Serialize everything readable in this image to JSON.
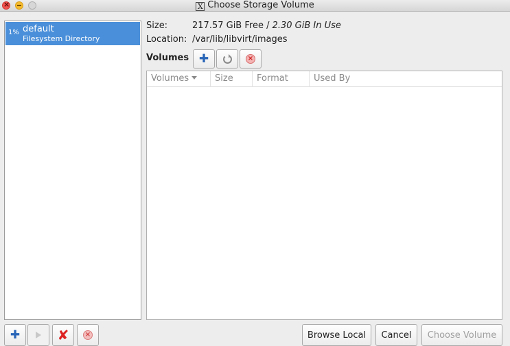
{
  "window": {
    "title": "Choose Storage Volume"
  },
  "pools": [
    {
      "usage": "1%",
      "name": "default",
      "type": "Filesystem Directory",
      "selected": true
    }
  ],
  "info": {
    "size_label": "Size:",
    "free": "217.57 GiB Free",
    "separator": " / ",
    "in_use": "2.30 GiB In Use",
    "location_label": "Location:",
    "location": "/var/lib/libvirt/images"
  },
  "volumes": {
    "heading": "Volumes",
    "columns": [
      "Volumes",
      "Size",
      "Format",
      "Used By"
    ],
    "rows": []
  },
  "buttons": {
    "browse_local": "Browse Local",
    "cancel": "Cancel",
    "choose_volume": "Choose Volume"
  },
  "icons": {
    "add_volume": "plus-icon",
    "refresh": "refresh-icon",
    "delete_volume": "stop-icon",
    "add_pool": "plus-icon",
    "start_pool": "play-icon",
    "delete_pool": "x-icon",
    "stop_pool": "stop-icon"
  },
  "colors": {
    "selection": "#4a8fd9",
    "accent": "#2a66b8"
  }
}
